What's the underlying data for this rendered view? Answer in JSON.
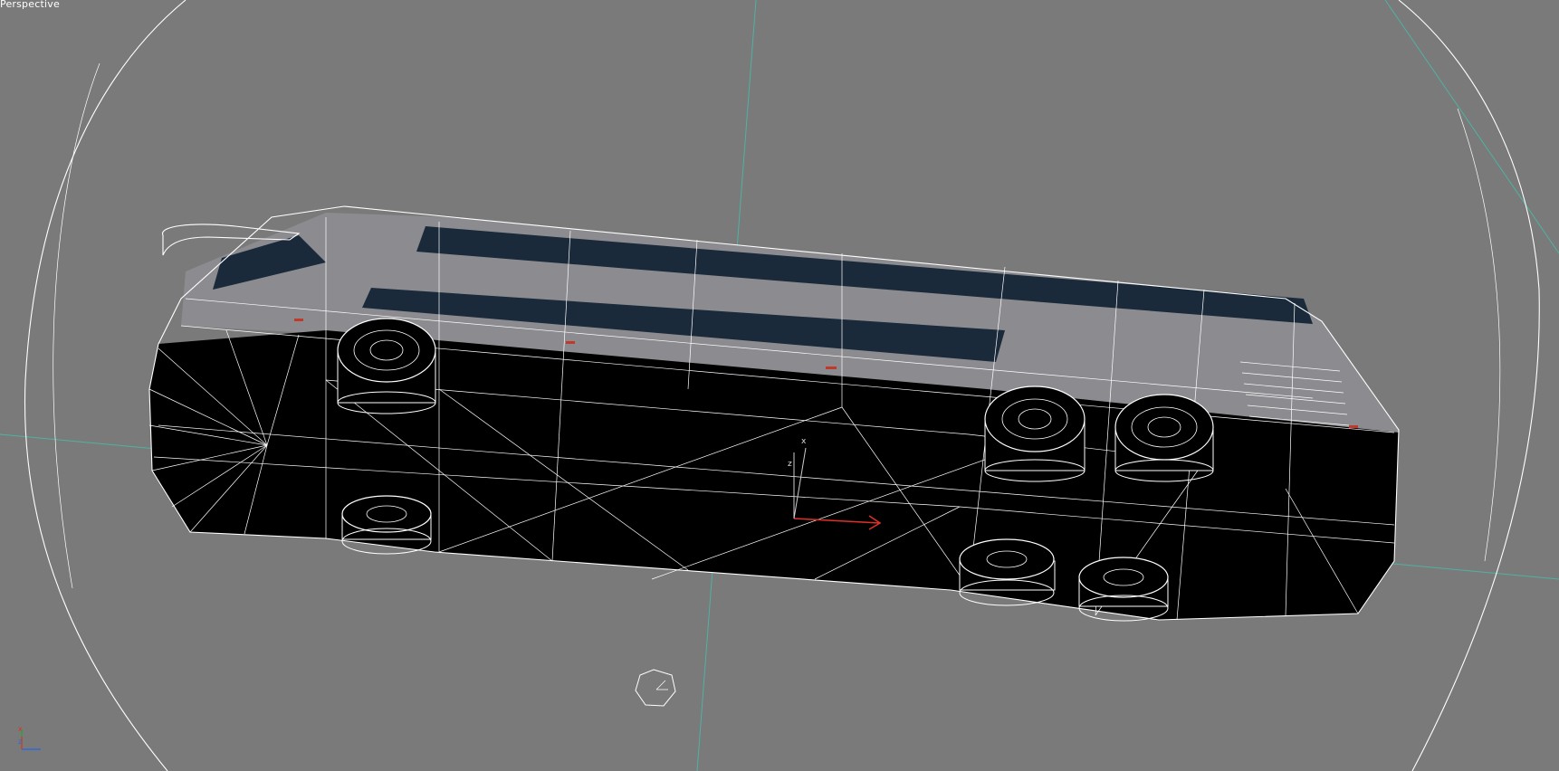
{
  "viewport": {
    "label": "Perspective",
    "background_color": "#7a7a7a",
    "grid_color": "#4fb2a2",
    "wireframe_color": "#ffffff"
  },
  "axis_tripod": {
    "labels": [
      "x",
      "z"
    ]
  },
  "gizmo": {
    "labels": [
      "x",
      "z"
    ]
  },
  "icons": {
    "view_cube": "view-cube-icon",
    "axis_tripod": "axis-tripod-icon",
    "transform_gizmo": "transform-gizmo-icon"
  }
}
